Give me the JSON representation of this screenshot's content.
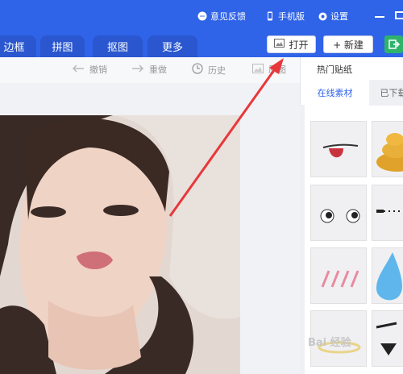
{
  "titlebar": {
    "feedback": "意见反馈",
    "mobile": "手机版",
    "settings": "设置"
  },
  "tabs": [
    {
      "label": "边框"
    },
    {
      "label": "拼图"
    },
    {
      "label": "抠图"
    },
    {
      "label": "更多"
    }
  ],
  "actions": {
    "open": "打开",
    "new": "+ 新建"
  },
  "toolbar": {
    "undo": "撤销",
    "redo": "重做",
    "history": "历史",
    "original": "原图"
  },
  "panel": {
    "title": "热门贴纸",
    "tab_online": "在线素材",
    "tab_downloaded": "已下载"
  },
  "watermark": "Bai 经验"
}
